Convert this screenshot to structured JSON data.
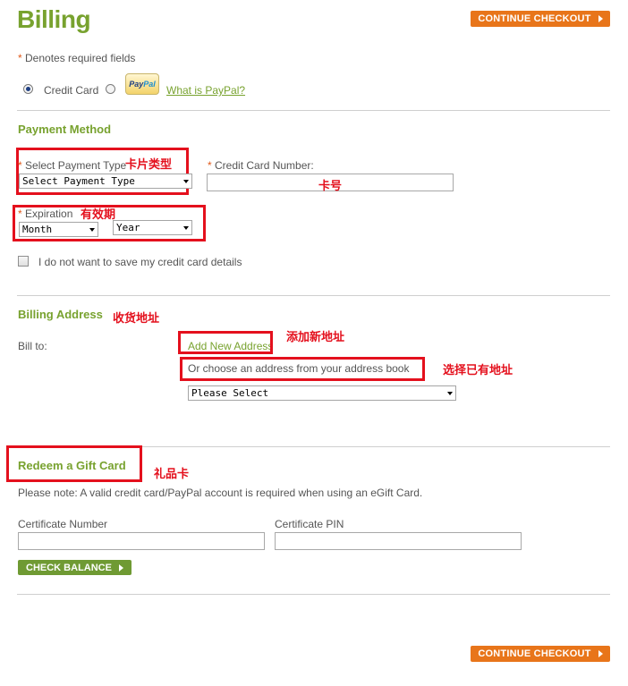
{
  "header": {
    "title": "Billing",
    "continue_label": "CONTINUE CHECKOUT"
  },
  "required_note": {
    "star": "*",
    "text": " Denotes required fields"
  },
  "payment_options": {
    "credit_card_label": "Credit Card",
    "paypal_logo_a": "Pay",
    "paypal_logo_b": "Pal",
    "paypal_link": "What is PayPal?"
  },
  "payment_method": {
    "title": "Payment Method",
    "select_type_label": "Select Payment Type",
    "select_type_value": "Select Payment Type",
    "card_number_label": "Credit Card Number:",
    "expiration_label": "Expiration",
    "month_value": "Month",
    "year_value": "Year",
    "no_save_label": "I do not want to save my credit card details"
  },
  "billing_address": {
    "title": "Billing Address",
    "bill_to_label": "Bill to:",
    "add_new_link": "Add New Address",
    "choose_text": "Or choose an address from your address book",
    "address_select_value": "Please Select"
  },
  "gift_card": {
    "title": "Redeem a Gift Card",
    "note": "Please note: A valid credit card/PayPal account is required when using an eGift Card.",
    "cert_number_label": "Certificate Number",
    "cert_pin_label": "Certificate PIN",
    "check_balance_label": "CHECK BALANCE"
  },
  "footer": {
    "continue_label": "CONTINUE CHECKOUT"
  },
  "annotations": {
    "card_type": "卡片类型",
    "card_number": "卡号",
    "expiry": "有效期",
    "billing_address": "收货地址",
    "add_address": "添加新地址",
    "choose_address": "选择已有地址",
    "gift_card": "礼品卡"
  }
}
